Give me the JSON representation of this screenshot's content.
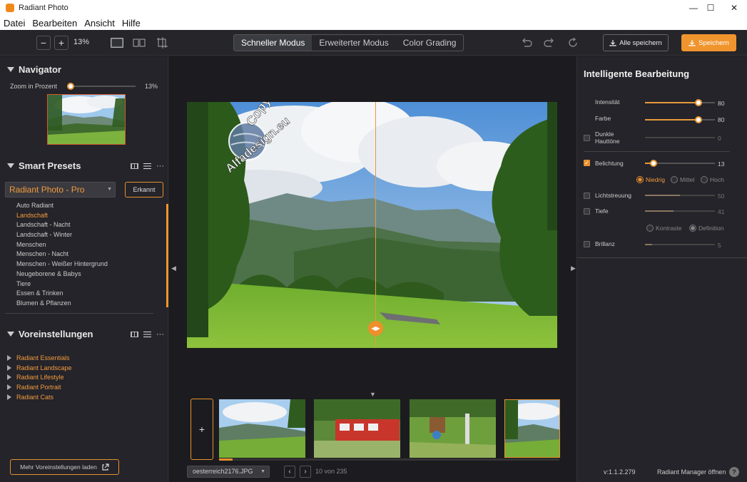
{
  "window": {
    "title": "Radiant Photo",
    "minimize": "—",
    "maximize": "☐",
    "close": "✕"
  },
  "menu": [
    "Datei",
    "Bearbeiten",
    "Ansicht",
    "Hilfe"
  ],
  "toolbar": {
    "zoom_out": "−",
    "zoom_in": "+",
    "zoom_value": "13%",
    "modes": [
      "Schneller Modus",
      "Erweiterter Modus",
      "Color Grading"
    ],
    "active_mode": "Schneller Modus",
    "save_all_label": "Alle speichern",
    "save_label": "Speichern",
    "accent_color": "#f0952e"
  },
  "navigator": {
    "title": "Navigator",
    "zoom_label": "Zoom in Prozent",
    "zoom_value": "13%",
    "zoom_fraction": 0.13
  },
  "smart_presets": {
    "title": "Smart Presets",
    "selected_pack": "Radiant Photo - Pro",
    "detected_button": "Erkannt",
    "items": [
      "Auto Radiant",
      "Landschaft",
      "Landschaft - Nacht",
      "Landschaft - Winter",
      "Menschen",
      "Menschen - Nacht",
      "Menschen - Weißer Hintergrund",
      "Neugeborene & Babys",
      "Tiere",
      "Essen & Trinken",
      "Blumen & Pflanzen"
    ],
    "active_item": "Landschaft"
  },
  "voreinstellungen": {
    "title": "Voreinstellungen",
    "items": [
      "Radiant Essentials",
      "Radiant Landscape",
      "Radiant Lifestyle",
      "Radiant Portrait",
      "Radiant Cats"
    ],
    "more_button": "Mehr Voreinstellungen laden"
  },
  "watermark": {
    "text_top": "Copyright by",
    "text_bottom": "Alfadesign.eu"
  },
  "filmstrip": {
    "add_label": "+",
    "file_name": "oesterreich2176.JPG",
    "prev": "‹",
    "next": "›",
    "count": "10 von 235",
    "progress_fraction": 0.04
  },
  "edit_panel": {
    "title": "Intelligente Bearbeitung",
    "params": {
      "intensitaet": {
        "label": "Intensität",
        "value": "80"
      },
      "farbe": {
        "label": "Farbe",
        "value": "80"
      },
      "dunkle_hauttoene": {
        "label": "Dunkle Hauttöne",
        "value": "0",
        "checked": false
      },
      "belichtung": {
        "label": "Belichtung",
        "value": "13",
        "checked": true
      },
      "lichtstreuung": {
        "label": "Lichtstreuung",
        "value": "50",
        "checked": false
      },
      "tiefe": {
        "label": "Tiefe",
        "value": "41",
        "checked": false
      },
      "brillanz": {
        "label": "Brillanz",
        "value": "5",
        "checked": false
      }
    },
    "belichtung_levels": [
      "Niedrig",
      "Mittel",
      "Hoch"
    ],
    "belichtung_level_selected": "Niedrig",
    "tiefe_options": [
      "Kontraste",
      "Definition"
    ],
    "tiefe_option_selected": "Definition"
  },
  "footer": {
    "version": "v:1.1.2.279",
    "manager_link": "Radiant Manager öffnen",
    "help": "?"
  }
}
